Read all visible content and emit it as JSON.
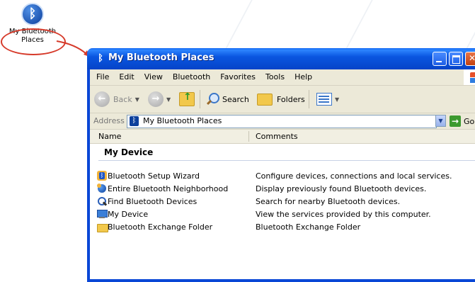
{
  "desktop_icon": {
    "label_line1": "My Bluetooth",
    "label_line2": "Places",
    "icon": "bluetooth-icon"
  },
  "window": {
    "title": "My Bluetooth Places",
    "title_icon": "bluetooth-icon"
  },
  "menu": [
    "File",
    "Edit",
    "View",
    "Bluetooth",
    "Favorites",
    "Tools",
    "Help"
  ],
  "toolbar": {
    "back_label": "Back",
    "search_label": "Search",
    "folders_label": "Folders"
  },
  "address": {
    "label": "Address",
    "value": "My Bluetooth Places",
    "go_label": "Go"
  },
  "columns": {
    "name": "Name",
    "comments": "Comments"
  },
  "group": {
    "title": "My Device"
  },
  "items": [
    {
      "name": "Bluetooth Setup Wizard",
      "comment": "Configure devices, connections and local services.",
      "icon": "setup-wizard-icon"
    },
    {
      "name": "Entire Bluetooth Neighborhood",
      "comment": "Display previously found Bluetooth devices.",
      "icon": "neighborhood-icon"
    },
    {
      "name": "Find Bluetooth Devices",
      "comment": "Search for nearby Bluetooth devices.",
      "icon": "find-devices-icon"
    },
    {
      "name": "My Device",
      "comment": "View the services provided by this computer.",
      "icon": "my-device-icon"
    },
    {
      "name": "Bluetooth Exchange Folder",
      "comment": "Bluetooth Exchange Folder",
      "icon": "folder-icon"
    }
  ],
  "colors": {
    "titlebar": "#0a56e0",
    "highlight_circle": "#d63a2a",
    "window_bg": "#ece9d8"
  }
}
